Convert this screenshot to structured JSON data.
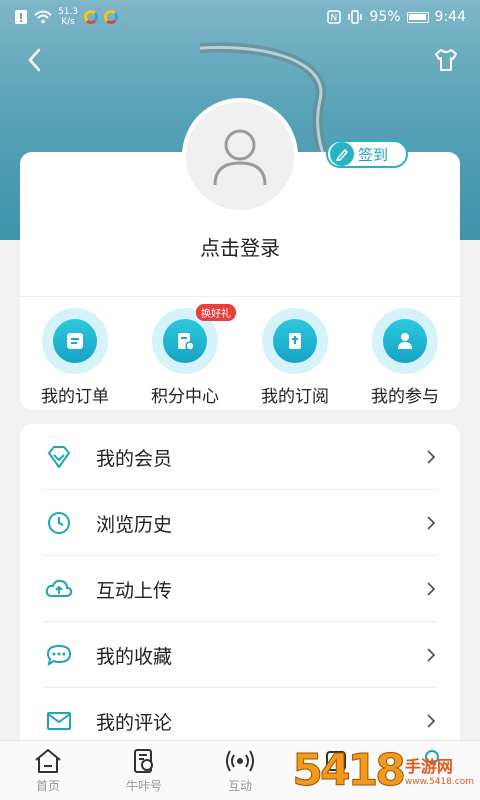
{
  "status_bar": {
    "speed": "51.3",
    "speed_unit": "K/s",
    "battery": "95%",
    "time": "9:44"
  },
  "profile": {
    "login_label": "点击登录",
    "signin_label": "签到"
  },
  "quick_actions": [
    {
      "label": "我的订单",
      "icon": "order-icon"
    },
    {
      "label": "积分中心",
      "icon": "points-icon",
      "badge": "换好礼"
    },
    {
      "label": "我的订阅",
      "icon": "bookmark-icon"
    },
    {
      "label": "我的参与",
      "icon": "person-icon"
    }
  ],
  "menu": [
    {
      "label": "我的会员",
      "icon": "diamond-icon"
    },
    {
      "label": "浏览历史",
      "icon": "clock-icon"
    },
    {
      "label": "互动上传",
      "icon": "cloud-upload-icon"
    },
    {
      "label": "我的收藏",
      "icon": "chat-icon"
    },
    {
      "label": "我的评论",
      "icon": "mail-icon"
    }
  ],
  "tabbar": [
    {
      "label": "首页",
      "icon": "home-icon"
    },
    {
      "label": "牛咔号",
      "icon": "doc-icon"
    },
    {
      "label": "互动",
      "icon": "broadcast-icon"
    },
    {
      "label": "",
      "icon": "tab4-icon"
    },
    {
      "label": "",
      "icon": "tab5-icon"
    }
  ],
  "watermark": {
    "number": "5418",
    "text": "手游网",
    "url": "www.5418.com"
  },
  "colors": {
    "accent": "#1fa5b8",
    "badge": "#e8403e"
  }
}
